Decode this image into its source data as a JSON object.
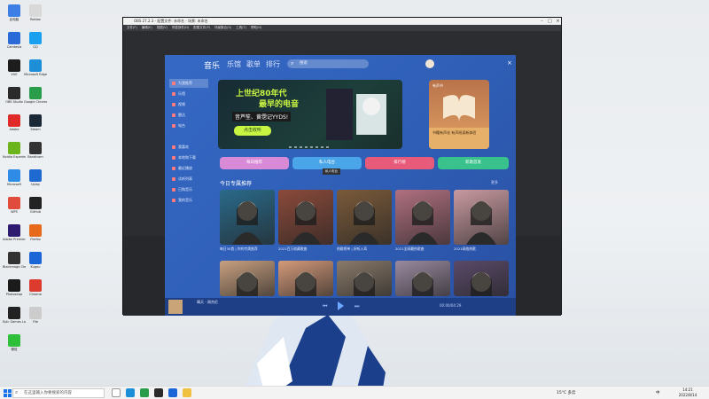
{
  "desktop": {
    "icons": [
      {
        "label": "此电脑",
        "color": "#3d7ee6"
      },
      {
        "label": "Camtasia",
        "color": "#2a6bd8"
      },
      {
        "label": "VUE",
        "color": "#1d1d1d"
      },
      {
        "label": "OBS Studio",
        "color": "#2b2b2b"
      },
      {
        "label": "Adobe",
        "color": "#e02a2a"
      },
      {
        "label": "Nvidia Experience",
        "color": "#6bb41c"
      },
      {
        "label": "Microsoft",
        "color": "#2e8be6"
      },
      {
        "label": "WPS",
        "color": "#e24c3c"
      },
      {
        "label": "Adobe Premiere",
        "color": "#2e1a6e"
      },
      {
        "label": "Blackmagic Design",
        "color": "#333333"
      },
      {
        "label": "Photoshop",
        "color": "#1b1b1b"
      },
      {
        "label": "Epic Games Launcher",
        "color": "#222222"
      },
      {
        "label": "微信",
        "color": "#2fbf3a"
      },
      {
        "label": "Roblox",
        "color": "#d9d9d9"
      },
      {
        "label": "QQ",
        "color": "#1aa0f0"
      },
      {
        "label": "Microsoft Edge",
        "color": "#1c8fd8"
      },
      {
        "label": "Google Chrome",
        "color": "#2a9d4a"
      },
      {
        "label": "Steam",
        "color": "#1b2838"
      },
      {
        "label": "Bandicam",
        "color": "#333333"
      },
      {
        "label": "Uplay",
        "color": "#1f6ad1"
      },
      {
        "label": "GitHub",
        "color": "#222222"
      },
      {
        "label": "Firefox",
        "color": "#e66a1a"
      },
      {
        "label": "Kugou",
        "color": "#1a66d6"
      },
      {
        "label": "Chrome",
        "color": "#dc3b2d"
      },
      {
        "label": "File",
        "color": "#cccccc"
      }
    ]
  },
  "obs": {
    "title": "OBS 27.2.3 - 配置文件: 未命名 - 场景: 未命名",
    "menu": [
      "文件(F)",
      "编辑(E)",
      "视图(V)",
      "停靠部件(D)",
      "配置文件(P)",
      "场景集合(S)",
      "工具(T)",
      "帮助(H)"
    ]
  },
  "music": {
    "brand": "音乐",
    "nav": [
      "乐馆",
      "歌单",
      "排行"
    ],
    "search_placeholder": "搜索",
    "sidebar": [
      "为我推荐",
      "乐馆",
      "视频",
      "雷达",
      "电台",
      "我喜欢",
      "本地和下载",
      "最近播放",
      "试听列表",
      "已购音乐",
      "我的音乐"
    ],
    "banner": {
      "line1": "上世纪80年代",
      "line2": "最早的电音",
      "line3": "音芦笙、黄霑记YYDS!",
      "button": "点击收听"
    },
    "promo": {
      "tag": "有声书",
      "caption": "书籍有声化\n有声阅读新体验"
    },
    "quick": [
      {
        "label": "每日推荐",
        "color": "#d88ad6"
      },
      {
        "label": "私人电台",
        "color": "#4aa6e8"
      },
      {
        "label": "排行榜",
        "color": "#e85a7a"
      },
      {
        "label": "新歌首发",
        "color": "#3ac28c"
      }
    ],
    "tooltip": "私人电台",
    "section_title": "今日专属推荐",
    "more": "更多",
    "cards_row1": [
      {
        "title": "每日30首 | 你的专属推荐",
        "color": "#2a6a8a"
      },
      {
        "title": "2021百万收藏歌曲",
        "color": "#8a4a3a"
      },
      {
        "title": "热歌榜单 | 好听入耳",
        "color": "#7a5a3a"
      },
      {
        "title": "2021全网最热歌曲",
        "color": "#b07080"
      },
      {
        "title": "2021网络热歌",
        "color": "#c89aa0"
      }
    ],
    "cards_row2": [
      {
        "title": "",
        "color": "#c8a080"
      },
      {
        "title": "",
        "color": "#d49a7a"
      },
      {
        "title": "",
        "color": "#8a7a6a"
      },
      {
        "title": "",
        "color": "#9a8aa0"
      },
      {
        "title": "",
        "color": "#5a4a6a"
      }
    ],
    "player": {
      "song": "晴天 - 周杰伦",
      "time": "00:00/04:29"
    }
  },
  "taskbar": {
    "search_placeholder": "在这里输入你要搜索的内容",
    "weather": "15°C 多云",
    "lang": "中",
    "time": "14:21",
    "date": "2022/8/14"
  }
}
